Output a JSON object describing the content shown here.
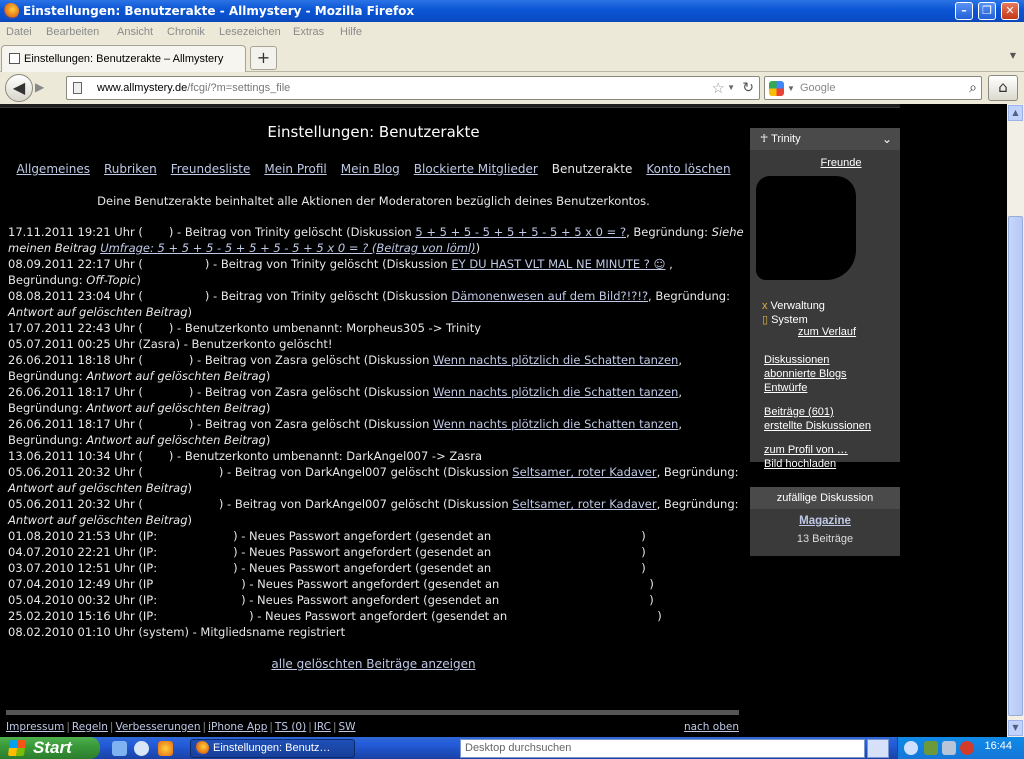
{
  "window": {
    "title": "Einstellungen: Benutzerakte - Allmystery - Mozilla Firefox"
  },
  "menu": [
    "Datei",
    "Bearbeiten",
    "Ansicht",
    "Chronik",
    "Lesezeichen",
    "Extras",
    "Hilfe"
  ],
  "tab": {
    "title": "Einstellungen: Benutzerakte – Allmystery",
    "new_tab": "+"
  },
  "nav": {
    "url_domain": "www.allmystery.de",
    "url_path": "/fcgi/?m=settings_file",
    "search_placeholder": "Google"
  },
  "page": {
    "title": "Einstellungen: Benutzerakte",
    "tabs": [
      {
        "label": "Allgemeines",
        "active": false
      },
      {
        "label": "Rubriken",
        "active": false
      },
      {
        "label": "Freundesliste",
        "active": false
      },
      {
        "label": "Mein Profil",
        "active": false
      },
      {
        "label": "Mein Blog",
        "active": false
      },
      {
        "label": "Blockierte Mitglieder",
        "active": false
      },
      {
        "label": "Benutzerakte",
        "active": true
      },
      {
        "label": "Konto löschen",
        "active": false
      }
    ],
    "intro": "Deine Benutzerakte beinhaltet alle Aktionen der Moderatoren bezüglich deines Benutzerkontos.",
    "show_all": "alle gelöschten Beiträge anzeigen"
  },
  "log": [
    [
      "17.11.2011 19:21 Uhr (",
      "gap:26",
      ") - Beitrag von Trinity gelöscht (Diskussion ",
      "link:5 + 5 + 5 - 5 + 5 + 5 - 5 + 5 x 0 = ?",
      ", Begründung: ",
      "i:Siehe"
    ],
    [
      "i:meinen Beitrag ",
      "ilink:Umfrage: 5 + 5 + 5 - 5 + 5 + 5 - 5 + 5 x 0 = ? (Beitrag von löml)",
      ")"
    ],
    [
      "08.09.2011 22:17 Uhr (",
      "gap:62",
      ") - Beitrag von Trinity gelöscht (Diskussion ",
      "link:EY DU HAST VLT MAL NE MINUTE ? ☺",
      " ,"
    ],
    [
      "Begründung: ",
      "i:Off-Topic",
      ")"
    ],
    [
      "08.08.2011 23:04 Uhr (",
      "gap:62",
      ") - Beitrag von Trinity gelöscht (Diskussion ",
      "link:Dämonenwesen auf dem Bild?!?!?",
      ", Begründung:"
    ],
    [
      "i:Antwort auf gelöschten Beitrag",
      ")"
    ],
    [
      "17.07.2011 22:43 Uhr (",
      "gap:26",
      ") - Benutzerkonto umbenannt: Morpheus305 -> Trinity"
    ],
    [
      "05.07.2011 00:25 Uhr (Zasra) - Benutzerkonto gelöscht!"
    ],
    [
      "26.06.2011 18:18 Uhr (",
      "gap:46",
      ") - Beitrag von Zasra gelöscht (Diskussion ",
      "link:Wenn nachts plötzlich die Schatten tanzen",
      ","
    ],
    [
      "Begründung: ",
      "i:Antwort auf gelöschten Beitrag",
      ")"
    ],
    [
      "26.06.2011 18:17 Uhr (",
      "gap:46",
      ") - Beitrag von Zasra gelöscht (Diskussion ",
      "link:Wenn nachts plötzlich die Schatten tanzen",
      ","
    ],
    [
      "Begründung: ",
      "i:Antwort auf gelöschten Beitrag",
      ")"
    ],
    [
      "26.06.2011 18:17 Uhr (",
      "gap:46",
      ") - Beitrag von Zasra gelöscht (Diskussion ",
      "link:Wenn nachts plötzlich die Schatten tanzen",
      ","
    ],
    [
      "Begründung: ",
      "i:Antwort auf gelöschten Beitrag",
      ")"
    ],
    [
      "13.06.2011 10:34 Uhr (",
      "gap:26",
      ") - Benutzerkonto umbenannt: DarkAngel007 -> Zasra"
    ],
    [
      "05.06.2011 20:32 Uhr (",
      "gap:76",
      ") - Beitrag von DarkAngel007 gelöscht (Diskussion ",
      "link:Seltsamer, roter Kadaver",
      ", Begründung:"
    ],
    [
      "i:Antwort auf gelöschten Beitrag",
      ")"
    ],
    [
      "05.06.2011 20:32 Uhr (",
      "gap:76",
      ") - Beitrag von DarkAngel007 gelöscht (Diskussion ",
      "link:Seltsamer, roter Kadaver",
      ", Begründung:"
    ],
    [
      "i:Antwort auf gelöschten Beitrag",
      ")"
    ],
    [
      "01.08.2010 21:53 Uhr (IP:",
      "gap:76",
      ") - Neues Passwort angefordert (gesendet an",
      "gap:150",
      ")"
    ],
    [
      "04.07.2010 22:21 Uhr (IP:",
      "gap:76",
      ") - Neues Passwort angefordert (gesendet an",
      "gap:150",
      ")"
    ],
    [
      "03.07.2010 12:51 Uhr (IP:",
      "gap:76",
      ") - Neues Passwort angefordert (gesendet an",
      "gap:150",
      ")"
    ],
    [
      "07.04.2010 12:49 Uhr (IP",
      "gap:88",
      ") - Neues Passwort angefordert (gesendet an",
      "gap:150",
      ")"
    ],
    [
      "05.04.2010 00:32 Uhr (IP:",
      "gap:84",
      ") - Neues Passwort angefordert (gesendet an",
      "gap:150",
      ")"
    ],
    [
      "25.02.2010 15:16 Uhr (IP:",
      "gap:92",
      ") - Neues Passwort angefordert (gesendet an",
      "gap:150",
      ")"
    ],
    [
      "08.02.2010 01:10 Uhr (system) - Mitgliedsname registriert"
    ]
  ],
  "sidebar": {
    "username": "Trinity",
    "friends": "Freunde",
    "roles": [
      "Verwaltung",
      "System"
    ],
    "history": "zum Verlauf",
    "links_a": [
      "Diskussionen",
      "abonnierte Blogs",
      "Entwürfe"
    ],
    "links_b": [
      "Beiträge (601)",
      "erstellte Diskussionen"
    ],
    "links_c": [
      "zum Profil von …",
      "Bild hochladen"
    ],
    "random_title": "zufällige Diskussion",
    "random_link": "Magazine",
    "random_count": "13 Beiträge"
  },
  "footer": {
    "links": [
      "Impressum",
      "Regeln",
      "Verbesserungen",
      "iPhone App",
      "TS (0)",
      "IRC",
      "SW"
    ],
    "top": "nach oben"
  },
  "taskbar": {
    "start": "Start",
    "task": "Einstellungen: Benutz…",
    "search_placeholder": "Desktop durchsuchen",
    "clock": "16:44"
  }
}
